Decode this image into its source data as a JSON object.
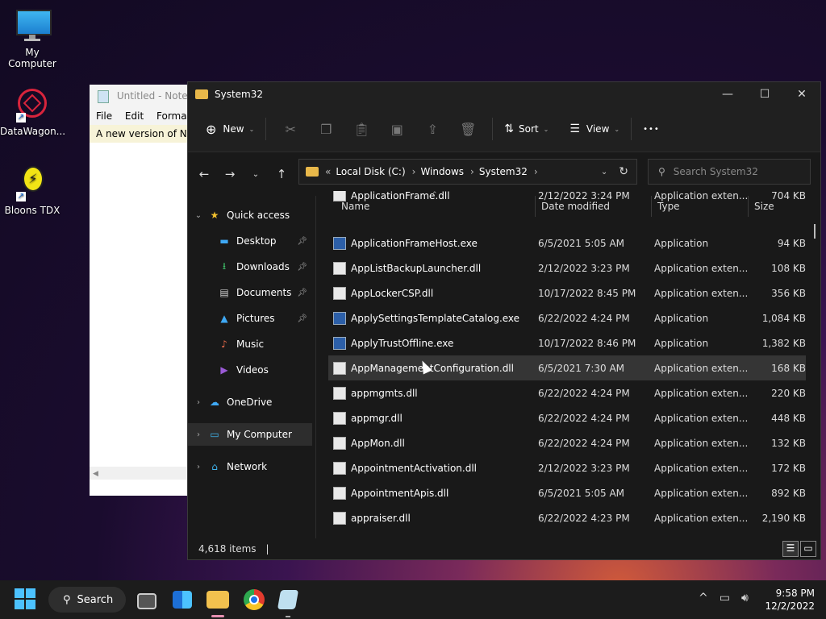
{
  "desktop": {
    "icons": [
      {
        "label": "My Computer"
      },
      {
        "label": "DataWagon..."
      },
      {
        "label": "Bloons TDX"
      }
    ]
  },
  "notepad": {
    "title": "Untitled - Notepa",
    "menu": [
      "File",
      "Edit",
      "Format"
    ],
    "text": "A new version of Not"
  },
  "explorer": {
    "title": "System32",
    "toolbar": {
      "new_label": "New",
      "sort_label": "Sort",
      "view_label": "View",
      "more_label": "•••"
    },
    "address": {
      "prefix": "«",
      "crumbs": [
        "Local Disk (C:)",
        "Windows",
        "System32"
      ]
    },
    "search": {
      "placeholder": "Search System32"
    },
    "nav": [
      {
        "label": "Quick access"
      },
      {
        "label": "Desktop"
      },
      {
        "label": "Downloads"
      },
      {
        "label": "Documents"
      },
      {
        "label": "Pictures"
      },
      {
        "label": "Music"
      },
      {
        "label": "Videos"
      },
      {
        "label": "OneDrive"
      },
      {
        "label": "My Computer"
      },
      {
        "label": "Network"
      }
    ],
    "columns": {
      "name": "Name",
      "date": "Date modified",
      "type": "Type",
      "size": "Size"
    },
    "rows": [
      {
        "name": "ApplicationFrame.dll",
        "date": "2/12/2022 3:24 PM",
        "type": "Application exten...",
        "size": "704 KB"
      },
      {
        "name": "ApplicationFrameHost.exe",
        "date": "6/5/2021 5:05 AM",
        "type": "Application",
        "size": "94 KB"
      },
      {
        "name": "AppListBackupLauncher.dll",
        "date": "2/12/2022 3:23 PM",
        "type": "Application exten...",
        "size": "108 KB"
      },
      {
        "name": "AppLockerCSP.dll",
        "date": "10/17/2022 8:45 PM",
        "type": "Application exten...",
        "size": "356 KB"
      },
      {
        "name": "ApplySettingsTemplateCatalog.exe",
        "date": "6/22/2022 4:24 PM",
        "type": "Application",
        "size": "1,084 KB"
      },
      {
        "name": "ApplyTrustOffline.exe",
        "date": "10/17/2022 8:46 PM",
        "type": "Application",
        "size": "1,382 KB"
      },
      {
        "name": "AppManagementConfiguration.dll",
        "date": "6/5/2021 7:30 AM",
        "type": "Application exten...",
        "size": "168 KB"
      },
      {
        "name": "appmgmts.dll",
        "date": "6/22/2022 4:24 PM",
        "type": "Application exten...",
        "size": "220 KB"
      },
      {
        "name": "appmgr.dll",
        "date": "6/22/2022 4:24 PM",
        "type": "Application exten...",
        "size": "448 KB"
      },
      {
        "name": "AppMon.dll",
        "date": "6/22/2022 4:24 PM",
        "type": "Application exten...",
        "size": "132 KB"
      },
      {
        "name": "AppointmentActivation.dll",
        "date": "2/12/2022 3:23 PM",
        "type": "Application exten...",
        "size": "172 KB"
      },
      {
        "name": "AppointmentApis.dll",
        "date": "6/5/2021 5:05 AM",
        "type": "Application exten...",
        "size": "892 KB"
      },
      {
        "name": "appraiser.dll",
        "date": "6/22/2022 4:23 PM",
        "type": "Application exten...",
        "size": "2,190 KB"
      }
    ],
    "status": {
      "count": "4,618 items"
    }
  },
  "taskbar": {
    "search_label": "Search",
    "time": "9:58 PM",
    "date": "12/2/2022"
  }
}
